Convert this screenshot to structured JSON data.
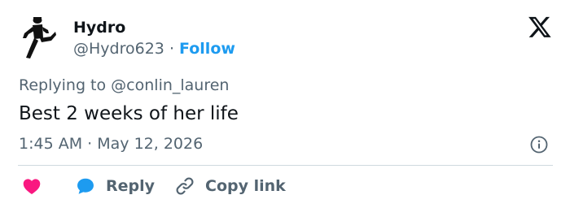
{
  "author": {
    "display_name": "Hydro",
    "handle": "@Hydro623",
    "separator": "·",
    "follow_label": "Follow"
  },
  "replying": {
    "prefix": "Replying to",
    "mention": "@conlin_lauren"
  },
  "tweet": {
    "text": "Best 2 weeks of her life"
  },
  "meta": {
    "time": "1:45 AM",
    "separator": "·",
    "date": "May 12, 2026"
  },
  "actions": {
    "reply_label": "Reply",
    "copy_label": "Copy link"
  },
  "icons": {
    "brand": "x-logo-icon",
    "info": "info-icon",
    "like": "heart-icon",
    "reply": "speech-bubble-icon",
    "copy": "link-icon"
  },
  "colors": {
    "follow": "#1d9bf0",
    "heart": "#f91880",
    "reply_bubble": "#1d9bf0",
    "muted": "#536471",
    "text": "#0f1419"
  }
}
